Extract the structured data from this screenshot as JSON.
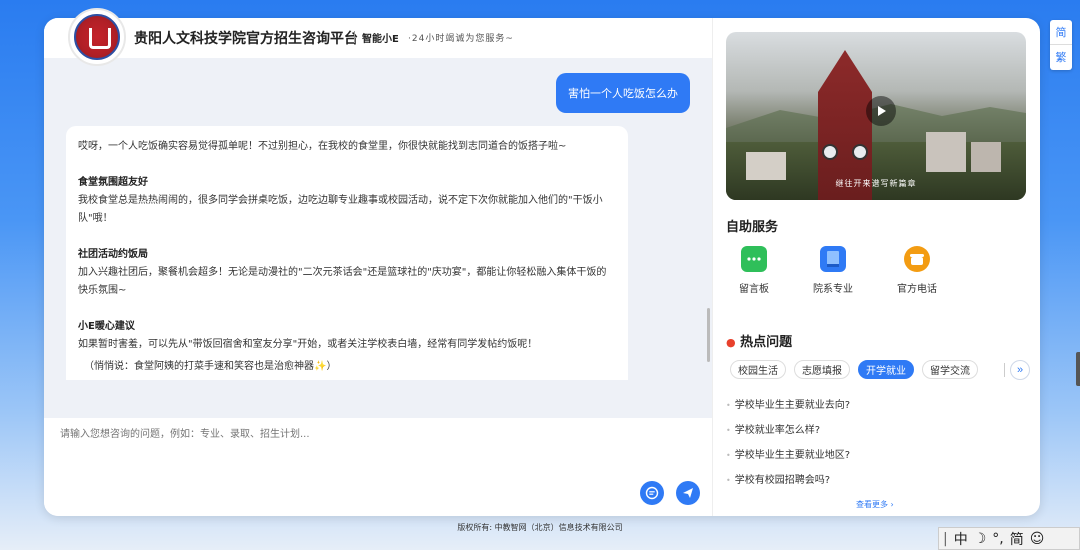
{
  "header": {
    "title": "贵阳人文科技学院官方招生咨询平台",
    "brand": "智能小E",
    "subtitle": "·24小时竭诚为您服务~"
  },
  "chat": {
    "user_message": "害怕一个人吃饭怎么办",
    "bot_intro": "哎呀，一个人吃饭确实容易觉得孤单呢！不过别担心，在我校的食堂里，你很快就能找到志同道合的饭搭子啦~",
    "sections": [
      {
        "title": "食堂氛围超友好",
        "body": "我校食堂总是热热闹闹的，很多同学会拼桌吃饭，边吃边聊专业趣事或校园活动，说不定下次你就能加入他们的\"干饭小队\"哦！"
      },
      {
        "title": "社团活动约饭局",
        "body": "加入兴趣社团后，聚餐机会超多！无论是动漫社的\"二次元茶话会\"还是篮球社的\"庆功宴\"，都能让你轻松融入集体干饭的快乐氛围~"
      },
      {
        "title": "小E暖心建议",
        "body": "如果暂时害羞，可以先从\"带饭回宿舍和室友分享\"开始，或者关注学校表白墙，经常有同学发帖约饭呢！"
      }
    ],
    "note": "（悄悄说：食堂阿姨的打菜手速和笑容也是治愈神器✨）"
  },
  "input": {
    "placeholder": "请输入您想咨询的问题，例如：专业、录取、招生计划..."
  },
  "video": {
    "caption": "继往开来谱写新篇章"
  },
  "self_service": {
    "title": "自助服务",
    "items": [
      {
        "label": "留言板",
        "icon": "message-board-icon",
        "color": "#2fbf5a"
      },
      {
        "label": "院系专业",
        "icon": "book-icon",
        "color": "#2f7af5"
      },
      {
        "label": "官方电话",
        "icon": "phone-icon",
        "color": "#f39c12"
      }
    ]
  },
  "hot": {
    "title": "热点问题",
    "tabs": [
      "校园生活",
      "志愿填报",
      "开学就业",
      "留学交流"
    ],
    "active_tab": "开学就业",
    "questions": [
      "学校毕业生主要就业去向?",
      "学校就业率怎么样?",
      "学校毕业生主要就业地区?",
      "学校有校园招聘会吗?"
    ],
    "more": "查看更多"
  },
  "footer": "版权所有: 中教智网（北京）信息技术有限公司",
  "lang": {
    "simplified": "简",
    "traditional": "繁"
  },
  "ime": {
    "items": [
      "中",
      "☽",
      "°,",
      "简",
      "☺"
    ]
  },
  "colors": {
    "accent": "#2f7af5",
    "bubble_user": "#2f7af5"
  }
}
